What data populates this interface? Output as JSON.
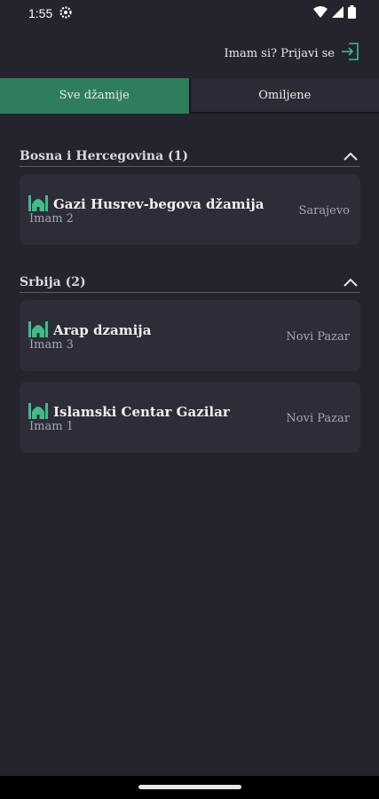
{
  "status": {
    "time": "1:55"
  },
  "header": {
    "login_label": "Imam si? Prijavi se"
  },
  "tabs": [
    {
      "label": "Sve džamije",
      "active": true
    },
    {
      "label": "Omiljene",
      "active": false
    }
  ],
  "sections": [
    {
      "title": "Bosna i Hercegovina (1)",
      "items": [
        {
          "name": "Gazi Husrev-begova džamija",
          "imam": "Imam 2",
          "city": "Sarajevo"
        }
      ]
    },
    {
      "title": "Srbija (2)",
      "items": [
        {
          "name": "Arap dzamija",
          "imam": "Imam 3",
          "city": "Novi Pazar"
        },
        {
          "name": "Islamski Centar Gazilar",
          "imam": "Imam 1",
          "city": "Novi Pazar"
        }
      ]
    }
  ],
  "colors": {
    "accent": "#2e7d5c",
    "icon_green": "#3ebd8a",
    "background": "#24232e",
    "card": "#2d2c39"
  },
  "icons": {
    "mosque": "mosque-icon",
    "login": "login-icon",
    "collapse": "chevron-up-icon"
  }
}
